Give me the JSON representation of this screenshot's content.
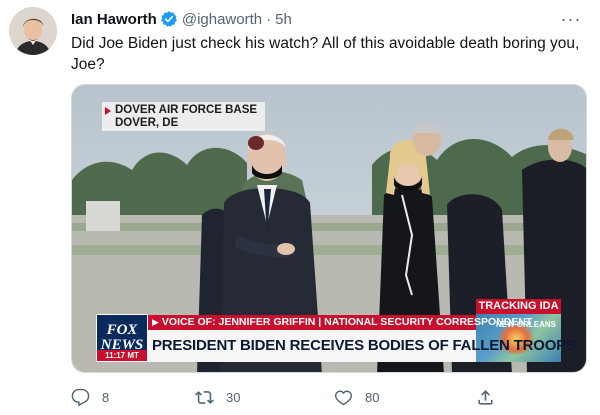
{
  "tweet": {
    "display_name": "Ian Haworth",
    "handle": "@ighaworth",
    "separator": "·",
    "time": "5h",
    "more_label": "···",
    "text": "Did Joe Biden just check his watch? All of this avoidable death boring you, Joe?",
    "verified_icon": "verified-badge-icon",
    "colors": {
      "verified": "#1d9bf0",
      "secondary_text": "#536471",
      "primary_text": "#0f1419"
    }
  },
  "media": {
    "location_line1": "DOVER AIR FORCE BASE",
    "location_line2": "DOVER, DE",
    "network_logo_line1": "FOX",
    "network_logo_line2": "NEWS",
    "logo_time": "11:17 MT",
    "voice_bar": "VOICE OF: JENNIFER GRIFFIN | NATIONAL SECURITY CORRESPONDENT",
    "headline": "PRESIDENT BIDEN RECEIVES BODIES OF FALLEN TROOPS",
    "tracking_label": "TRACKING IDA",
    "tracking_city": "NEW ORLEANS",
    "colors": {
      "fox_red": "#c8102e",
      "fox_navy": "#0a2a5e"
    }
  },
  "actions": {
    "reply_count": "8",
    "retweet_count": "30",
    "like_count": "80",
    "icons": [
      "reply-icon",
      "retweet-icon",
      "like-icon",
      "share-icon"
    ]
  }
}
